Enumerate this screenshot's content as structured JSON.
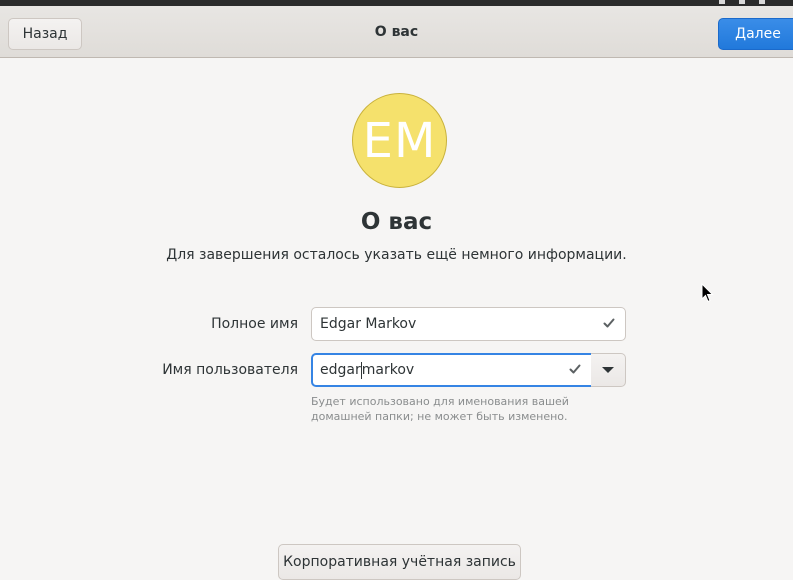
{
  "header": {
    "title": "О вас",
    "back_label": "Назад",
    "next_label": "Далее"
  },
  "avatar": {
    "initials": "EM",
    "color": "#f5e16c"
  },
  "main": {
    "title": "О вас",
    "subtitle": "Для завершения осталось указать ещё немного информации."
  },
  "form": {
    "fullname_label": "Полное имя",
    "fullname_value": "Edgar Markov",
    "username_label": "Имя пользователя",
    "username_value_before_cursor": "edgar",
    "username_value_after_cursor": "markov",
    "hint": "Будет использовано для именования вашей домашней папки; не может быть изменено."
  },
  "enterprise_label": "Корпоративная учётная запись",
  "colors": {
    "accent": "#3584e4",
    "background": "#f6f5f4"
  },
  "icons": [
    "check-icon",
    "chevron-down-icon",
    "mouse-pointer-icon"
  ]
}
